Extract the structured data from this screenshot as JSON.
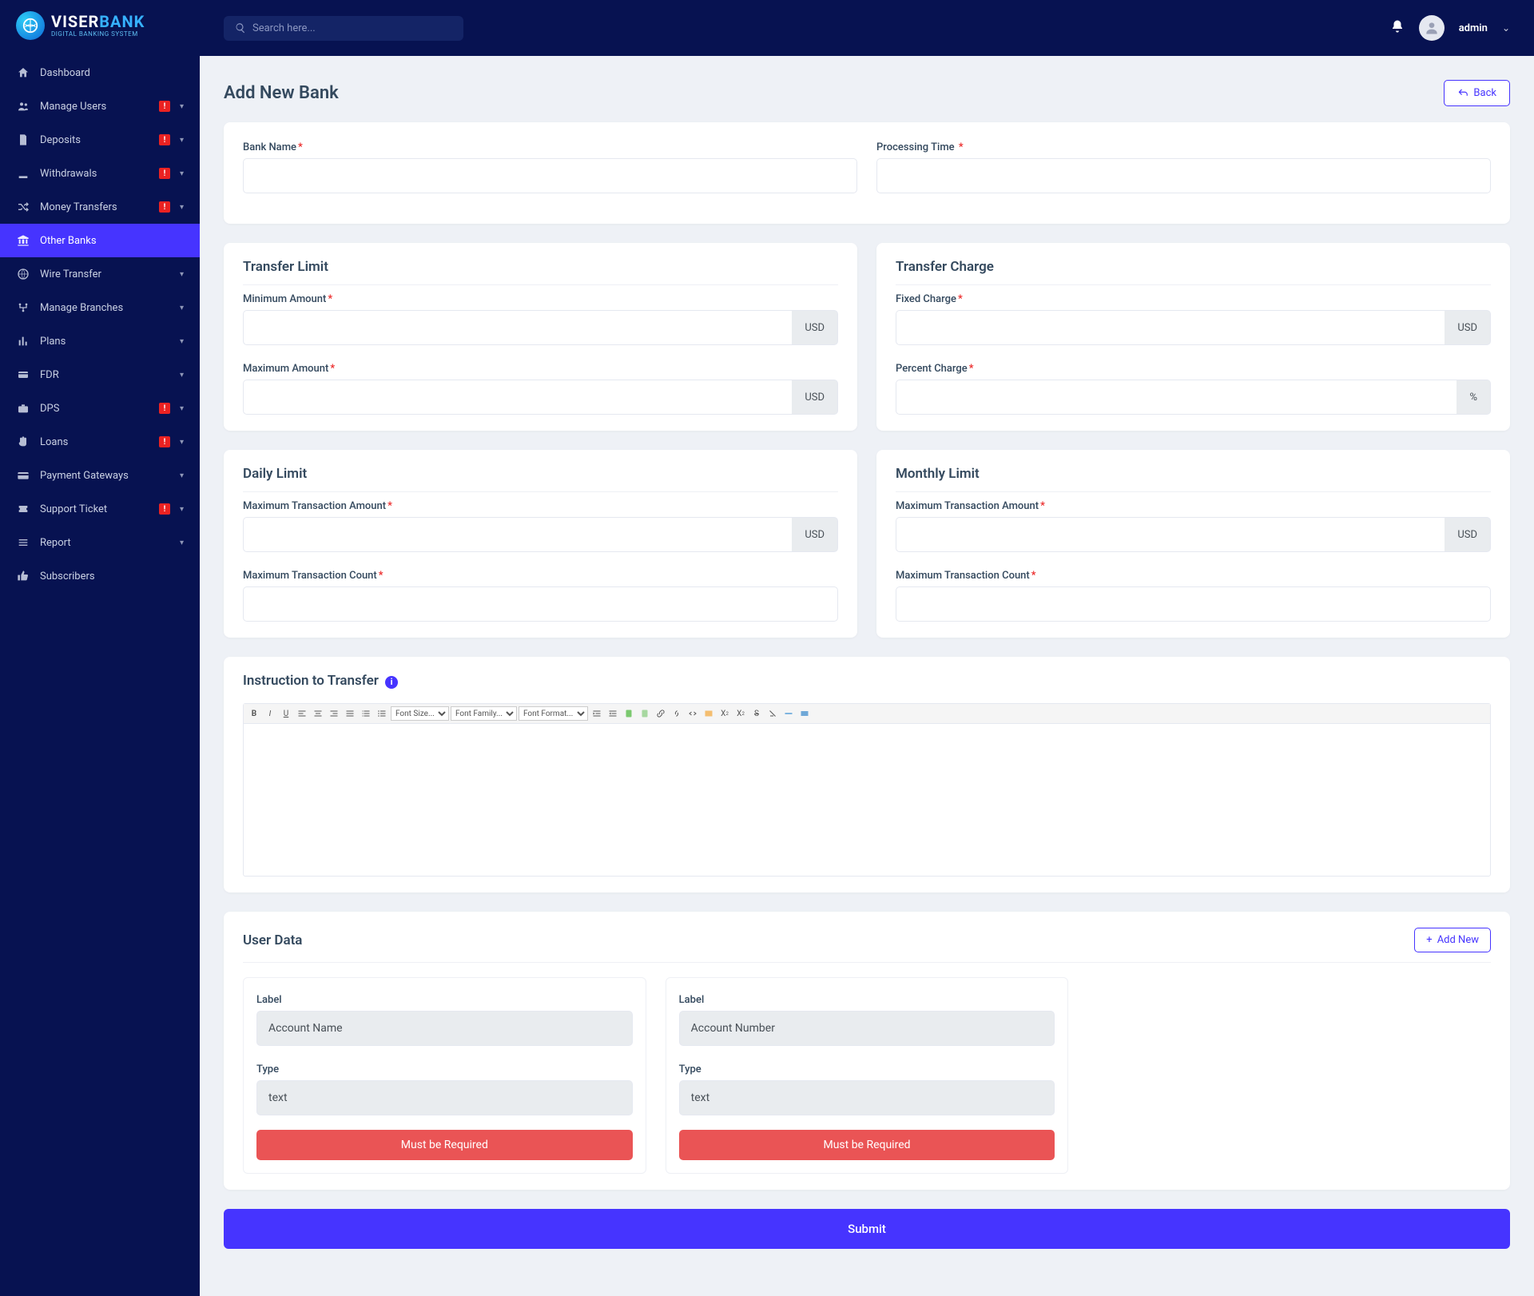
{
  "brand": {
    "name_a": "VISER",
    "name_b": "BANK",
    "tagline": "DIGITAL BANKING SYSTEM"
  },
  "search": {
    "placeholder": "Search here..."
  },
  "user": {
    "name": "admin"
  },
  "sidebar": {
    "items": [
      {
        "label": "Dashboard",
        "icon": "home",
        "badge": false,
        "chevron": false
      },
      {
        "label": "Manage Users",
        "icon": "users",
        "badge": true,
        "chevron": true
      },
      {
        "label": "Deposits",
        "icon": "file",
        "badge": true,
        "chevron": true
      },
      {
        "label": "Withdrawals",
        "icon": "withdraw",
        "badge": true,
        "chevron": true
      },
      {
        "label": "Money Transfers",
        "icon": "shuffle",
        "badge": true,
        "chevron": true
      },
      {
        "label": "Other Banks",
        "icon": "bank",
        "badge": false,
        "chevron": false,
        "active": true
      },
      {
        "label": "Wire Transfer",
        "icon": "wire",
        "badge": false,
        "chevron": true
      },
      {
        "label": "Manage Branches",
        "icon": "branch",
        "badge": false,
        "chevron": true
      },
      {
        "label": "Plans",
        "icon": "chart",
        "badge": false,
        "chevron": true
      },
      {
        "label": "FDR",
        "icon": "card",
        "badge": false,
        "chevron": true
      },
      {
        "label": "DPS",
        "icon": "briefcase",
        "badge": true,
        "chevron": true
      },
      {
        "label": "Loans",
        "icon": "hand",
        "badge": true,
        "chevron": true
      },
      {
        "label": "Payment Gateways",
        "icon": "credit",
        "badge": false,
        "chevron": true
      },
      {
        "label": "Support Ticket",
        "icon": "ticket",
        "badge": true,
        "chevron": true
      },
      {
        "label": "Report",
        "icon": "list",
        "badge": false,
        "chevron": true
      },
      {
        "label": "Subscribers",
        "icon": "thumb",
        "badge": false,
        "chevron": false
      }
    ]
  },
  "page": {
    "title": "Add New Bank",
    "back": "Back",
    "sections": {
      "bank_name": "Bank Name",
      "processing_time": "Processing Time",
      "transfer_limit": "Transfer Limit",
      "transfer_charge": "Transfer Charge",
      "minimum_amount": "Minimum Amount",
      "maximum_amount": "Maximum Amount",
      "fixed_charge": "Fixed Charge",
      "percent_charge": "Percent Charge",
      "daily_limit": "Daily Limit",
      "monthly_limit": "Monthly Limit",
      "max_txn_amount": "Maximum Transaction Amount",
      "max_txn_count": "Maximum Transaction Count",
      "instruction": "Instruction to Transfer",
      "user_data": "User Data",
      "add_new": "Add New",
      "label": "Label",
      "type": "Type",
      "must_required": "Must be Required",
      "submit": "Submit",
      "currency": "USD",
      "percent": "%"
    },
    "editor": {
      "font_size": "Font Size...",
      "font_family": "Font Family...",
      "font_format": "Font Format..."
    },
    "user_data_cards": [
      {
        "label": "Account Name",
        "type": "text"
      },
      {
        "label": "Account Number",
        "type": "text"
      }
    ]
  }
}
